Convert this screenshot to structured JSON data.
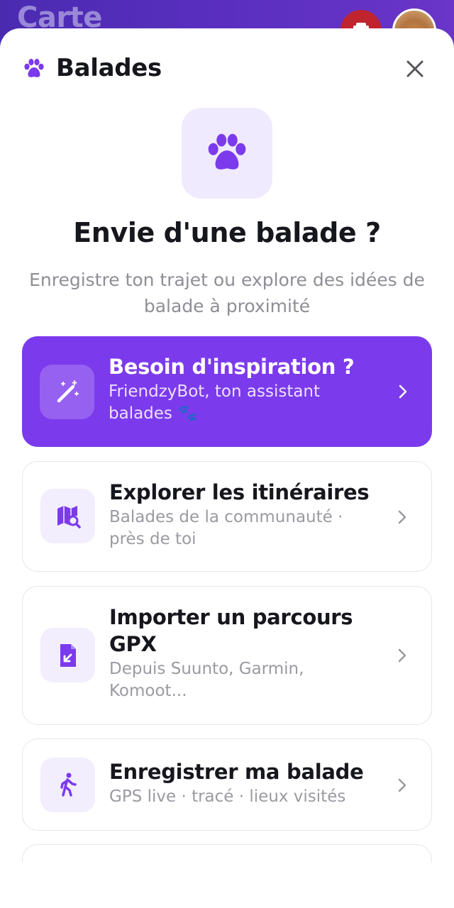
{
  "background": {
    "title": "Carte"
  },
  "sheet": {
    "title": "Balades",
    "close_icon": "close-icon"
  },
  "hero": {
    "title": "Envie d'une balade ?",
    "subtitle": "Enregistre ton trajet ou explore des idées de balade à proximité"
  },
  "cards": [
    {
      "title": "Besoin d'inspiration ?",
      "subtitle": "FriendzyBot, ton assistant balades 🐾",
      "icon": "magic-wand-icon"
    },
    {
      "title": "Explorer les itinéraires",
      "subtitle": "Balades de la communauté · près de toi",
      "icon": "map-search-icon"
    },
    {
      "title": "Importer un parcours GPX",
      "subtitle": "Depuis Suunto, Garmin, Komoot...",
      "icon": "file-import-icon"
    },
    {
      "title": "Enregistrer ma balade",
      "subtitle": "GPS live · tracé · lieux visités",
      "icon": "walking-icon"
    }
  ],
  "colors": {
    "accent": "#7c3aed",
    "accent_light": "#efeafe",
    "text_primary": "#16161d",
    "text_secondary": "#9a9aa2"
  }
}
